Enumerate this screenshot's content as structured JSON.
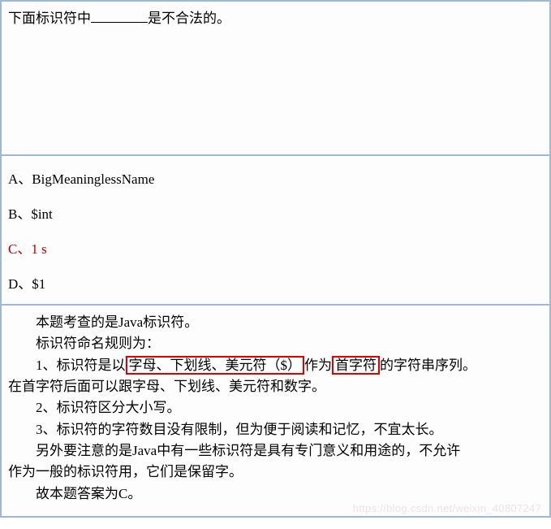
{
  "question": {
    "prefix": "下面标识符中",
    "suffix": "是不合法的。"
  },
  "options": {
    "a": "A、BigMeaninglessName",
    "b": "B、$int",
    "c": "C、1 s",
    "d": "D、$1"
  },
  "explanation": {
    "line1": "本题考查的是Java标识符。",
    "line2": "标识符命名规则为：",
    "line3a": "1、标识符是以",
    "line3_box1": "字母、下划线、美元符（$）",
    "line3b": "作为",
    "line3_box2": "首字符",
    "line3c": "的字符串序列。",
    "line3d": "在首字符后面可以跟字母、下划线、美元符和数字。",
    "line4": "2、标识符区分大小写。",
    "line5": "3、标识符的字符数目没有限制，但为便于阅读和记忆，不宜太长。",
    "line6a": "另外要注意的是Java中有一些标识符是具有专门意义和用途的，不允许",
    "line6b": "作为一般的标识符用，它们是保留字。",
    "line7": "故本题答案为C。"
  },
  "watermark": "https://blog.csdn.net/weixin_40807247"
}
